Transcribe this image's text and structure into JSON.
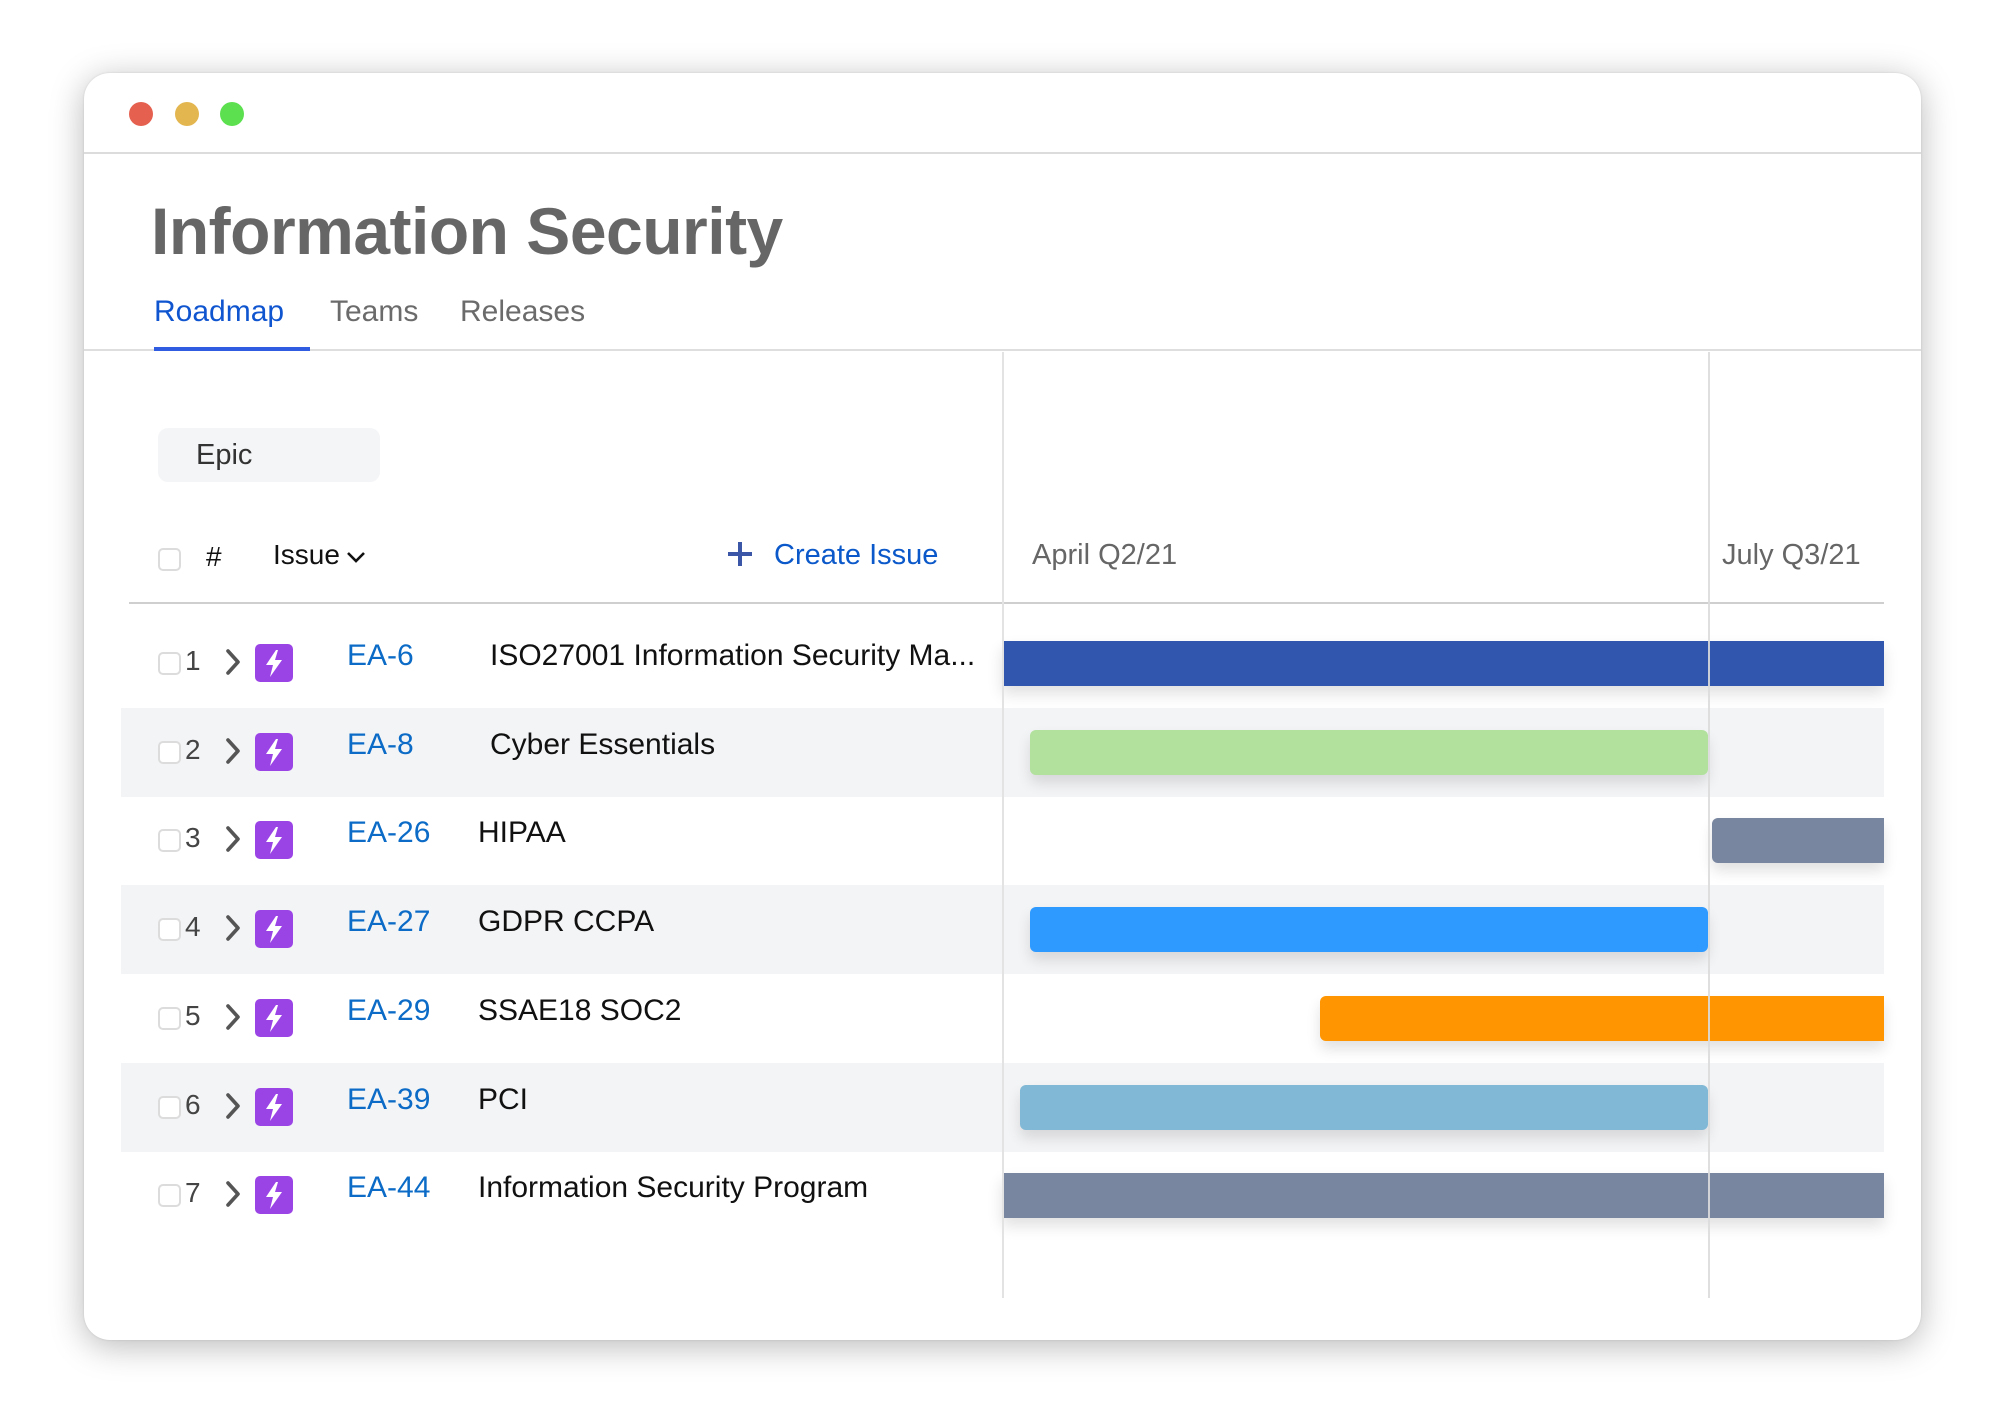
{
  "window": {
    "controls": [
      {
        "name": "close",
        "color": "#e5604f"
      },
      {
        "name": "minimize",
        "color": "#e3b64f"
      },
      {
        "name": "maximize",
        "color": "#5ce04f"
      }
    ]
  },
  "header": {
    "title": "Information Security",
    "tabs": [
      {
        "label": "Roadmap",
        "active": true
      },
      {
        "label": "Teams",
        "active": false
      },
      {
        "label": "Releases",
        "active": false
      }
    ]
  },
  "filter": {
    "label": "Epic"
  },
  "table": {
    "columns": {
      "number": "#",
      "issue": "Issue",
      "issue_sort_icon": "chevron-down-icon"
    },
    "create_issue_label": "Create Issue",
    "create_issue_icon": "plus-icon",
    "rows": [
      {
        "number": "1",
        "key": "EA-6",
        "summary": "ISO27001 Information Security Ma...",
        "icon": "epic-lightning-icon"
      },
      {
        "number": "2",
        "key": "EA-8",
        "summary": "Cyber Essentials",
        "icon": "epic-lightning-icon"
      },
      {
        "number": "3",
        "key": "EA-26",
        "summary": "HIPAA",
        "icon": "epic-lightning-icon"
      },
      {
        "number": "4",
        "key": "EA-27",
        "summary": "GDPR CCPA",
        "icon": "epic-lightning-icon"
      },
      {
        "number": "5",
        "key": "EA-29",
        "summary": "SSAE18 SOC2",
        "icon": "epic-lightning-icon"
      },
      {
        "number": "6",
        "key": "EA-39",
        "summary": "PCI",
        "icon": "epic-lightning-icon"
      },
      {
        "number": "7",
        "key": "EA-44",
        "summary": "Information Security Program",
        "icon": "epic-lightning-icon"
      }
    ]
  },
  "timeline": {
    "periods": [
      "April Q2/21",
      "July Q3/21"
    ],
    "visible_range_quarters": [
      0,
      1.3
    ],
    "bars": [
      {
        "key": "EA-6",
        "color": "#3056ad",
        "start": -0.05,
        "end": 1.35,
        "extends_left": true,
        "extends_right": true
      },
      {
        "key": "EA-8",
        "color": "#b1e19c",
        "start": 0.04,
        "end": 1.0,
        "extends_left": false,
        "extends_right": false
      },
      {
        "key": "EA-26",
        "color": "#7886a0",
        "start": 1.005,
        "end": 1.35,
        "extends_left": false,
        "extends_right": true
      },
      {
        "key": "EA-27",
        "color": "#2e9aff",
        "start": 0.04,
        "end": 1.0,
        "extends_left": false,
        "extends_right": false
      },
      {
        "key": "EA-29",
        "color": "#ff9500",
        "start": 0.45,
        "end": 1.35,
        "extends_left": false,
        "extends_right": true
      },
      {
        "key": "EA-39",
        "color": "#80b8d6",
        "start": 0.025,
        "end": 1.0,
        "extends_left": false,
        "extends_right": false
      },
      {
        "key": "EA-44",
        "color": "#7886a0",
        "start": -0.05,
        "end": 1.35,
        "extends_left": true,
        "extends_right": true
      }
    ]
  },
  "colors": {
    "accent": "#1055d0",
    "issue_key": "#0b6bc6",
    "epic_icon": "#9b44e6",
    "row_stripe": "#f3f4f6"
  }
}
